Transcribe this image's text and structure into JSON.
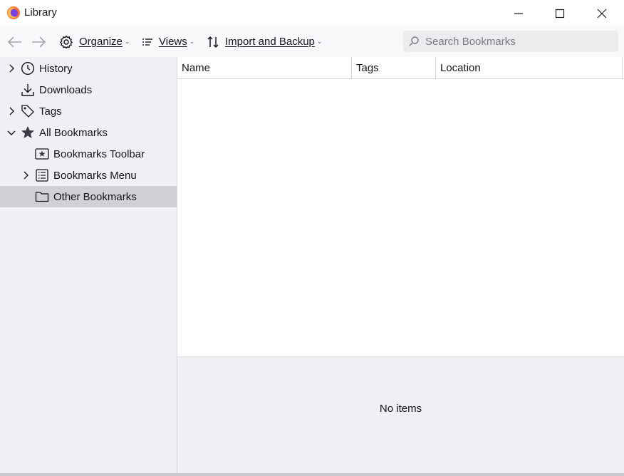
{
  "window": {
    "title": "Library",
    "app_icon": "firefox-icon"
  },
  "toolbar": {
    "organize_label": "Organize",
    "views_label": "Views",
    "import_label": "Import and Backup",
    "search_placeholder": "Search Bookmarks"
  },
  "sidebar": {
    "items": [
      {
        "label": "History",
        "icon": "clock-icon"
      },
      {
        "label": "Downloads",
        "icon": "download-icon"
      },
      {
        "label": "Tags",
        "icon": "tag-icon"
      },
      {
        "label": "All Bookmarks",
        "icon": "star-icon"
      },
      {
        "label": "Bookmarks Toolbar",
        "icon": "bookmarks-toolbar-icon"
      },
      {
        "label": "Bookmarks Menu",
        "icon": "bookmarks-menu-icon"
      },
      {
        "label": "Other Bookmarks",
        "icon": "folder-icon",
        "selected": true
      }
    ]
  },
  "table": {
    "columns": [
      "Name",
      "Tags",
      "Location"
    ]
  },
  "details": {
    "empty_text": "No items"
  },
  "colors": {
    "selection": "#d0d0d7",
    "background": "#f0f0f4"
  }
}
